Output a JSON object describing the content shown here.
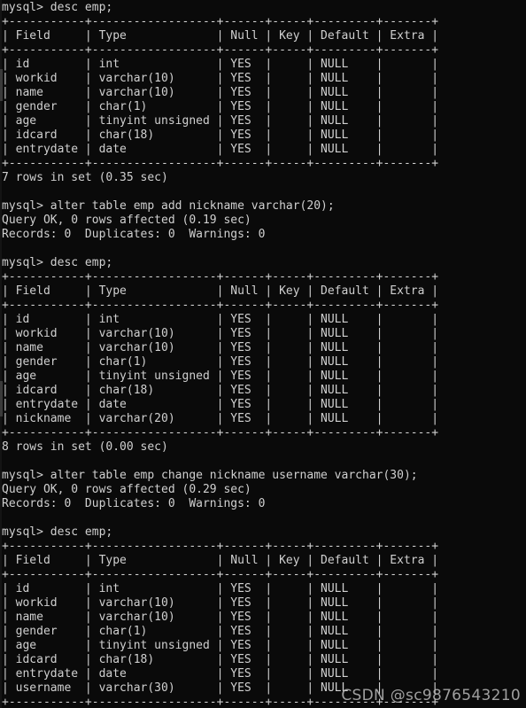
{
  "terminal": {
    "prompt": "mysql>",
    "background_color": "#0a0a0a",
    "text_color": "#d0d0d0",
    "font_size_px": 13,
    "line_height_px": 16,
    "columns": 82,
    "rows": 50
  },
  "watermark": {
    "text": "CSDN @sc9876543210",
    "color": "#b9b9b9"
  },
  "table_header": [
    "Field",
    "Type",
    "Null",
    "Key",
    "Default",
    "Extra"
  ],
  "commands": [
    {
      "id": "cmd1",
      "text": "desc emp;"
    },
    {
      "id": "cmd2",
      "text": "alter table emp add nickname varchar(20);"
    },
    {
      "id": "cmd3",
      "text": "desc emp;"
    },
    {
      "id": "cmd4",
      "text": "alter table emp change nickname username varchar(30);"
    },
    {
      "id": "cmd5",
      "text": "desc emp;"
    }
  ],
  "results": {
    "alter1": {
      "query_ok": "Query OK, 0 rows affected (0.19 sec)",
      "records": "Records: 0  Duplicates: 0  Warnings: 0"
    },
    "alter2": {
      "query_ok": "Query OK, 0 rows affected (0.29 sec)",
      "records": "Records: 0  Duplicates: 0  Warnings: 0"
    },
    "rows1": "7 rows in set (0.35 sec)",
    "rows2": "8 rows in set (0.00 sec)"
  },
  "tables": {
    "desc1": {
      "rows": [
        {
          "field": "id",
          "type": "int",
          "null": "YES",
          "key": "",
          "default": "NULL",
          "extra": ""
        },
        {
          "field": "workid",
          "type": "varchar(10)",
          "null": "YES",
          "key": "",
          "default": "NULL",
          "extra": ""
        },
        {
          "field": "name",
          "type": "varchar(10)",
          "null": "YES",
          "key": "",
          "default": "NULL",
          "extra": ""
        },
        {
          "field": "gender",
          "type": "char(1)",
          "null": "YES",
          "key": "",
          "default": "NULL",
          "extra": ""
        },
        {
          "field": "age",
          "type": "tinyint unsigned",
          "null": "YES",
          "key": "",
          "default": "NULL",
          "extra": ""
        },
        {
          "field": "idcard",
          "type": "char(18)",
          "null": "YES",
          "key": "",
          "default": "NULL",
          "extra": ""
        },
        {
          "field": "entrydate",
          "type": "date",
          "null": "YES",
          "key": "",
          "default": "NULL",
          "extra": ""
        }
      ]
    },
    "desc2": {
      "rows": [
        {
          "field": "id",
          "type": "int",
          "null": "YES",
          "key": "",
          "default": "NULL",
          "extra": ""
        },
        {
          "field": "workid",
          "type": "varchar(10)",
          "null": "YES",
          "key": "",
          "default": "NULL",
          "extra": ""
        },
        {
          "field": "name",
          "type": "varchar(10)",
          "null": "YES",
          "key": "",
          "default": "NULL",
          "extra": ""
        },
        {
          "field": "gender",
          "type": "char(1)",
          "null": "YES",
          "key": "",
          "default": "NULL",
          "extra": ""
        },
        {
          "field": "age",
          "type": "tinyint unsigned",
          "null": "YES",
          "key": "",
          "default": "NULL",
          "extra": ""
        },
        {
          "field": "idcard",
          "type": "char(18)",
          "null": "YES",
          "key": "",
          "default": "NULL",
          "extra": ""
        },
        {
          "field": "entrydate",
          "type": "date",
          "null": "YES",
          "key": "",
          "default": "NULL",
          "extra": ""
        },
        {
          "field": "nickname",
          "type": "varchar(20)",
          "null": "YES",
          "key": "",
          "default": "NULL",
          "extra": ""
        }
      ]
    },
    "desc3": {
      "rows": [
        {
          "field": "id",
          "type": "int",
          "null": "YES",
          "key": "",
          "default": "NULL",
          "extra": ""
        },
        {
          "field": "workid",
          "type": "varchar(10)",
          "null": "YES",
          "key": "",
          "default": "NULL",
          "extra": ""
        },
        {
          "field": "name",
          "type": "varchar(10)",
          "null": "YES",
          "key": "",
          "default": "NULL",
          "extra": ""
        },
        {
          "field": "gender",
          "type": "char(1)",
          "null": "YES",
          "key": "",
          "default": "NULL",
          "extra": ""
        },
        {
          "field": "age",
          "type": "tinyint unsigned",
          "null": "YES",
          "key": "",
          "default": "NULL",
          "extra": ""
        },
        {
          "field": "idcard",
          "type": "char(18)",
          "null": "YES",
          "key": "",
          "default": "NULL",
          "extra": ""
        },
        {
          "field": "entrydate",
          "type": "date",
          "null": "YES",
          "key": "",
          "default": "NULL",
          "extra": ""
        },
        {
          "field": "username",
          "type": "varchar(30)",
          "null": "YES",
          "key": "",
          "default": "NULL",
          "extra": ""
        }
      ]
    }
  },
  "column_widths": {
    "field": 10,
    "type": 17,
    "null": 5,
    "key": 4,
    "default": 8,
    "extra": 6
  }
}
